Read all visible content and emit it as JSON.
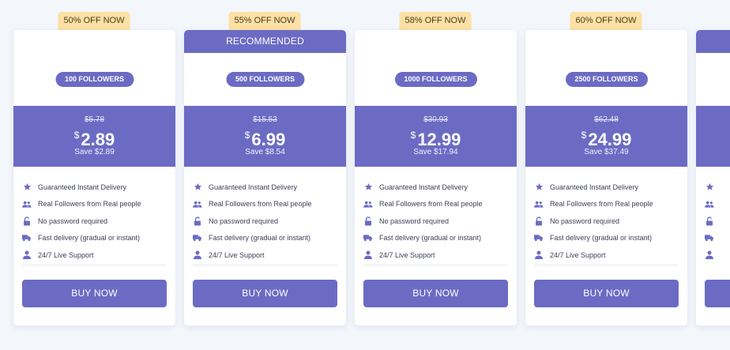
{
  "colors": {
    "accent": "#6b6bc4",
    "badge": "#fde0a4",
    "background": "#f3f6fb"
  },
  "features": [
    {
      "icon": "star-icon",
      "label": "Guaranteed Instant Delivery"
    },
    {
      "icon": "users-icon",
      "label": "Real Followers from Real people"
    },
    {
      "icon": "unlock-icon",
      "label": "No password required"
    },
    {
      "icon": "truck-icon",
      "label": "Fast delivery (gradual or instant)"
    },
    {
      "icon": "user-icon",
      "label": "24/7 Live Support"
    }
  ],
  "plans": [
    {
      "discount": "50% OFF NOW",
      "recommended": "",
      "package": "100 FOLLOWERS",
      "old_price": "$5.78",
      "currency": "$",
      "price": "2.89",
      "save": "Save $2.89",
      "button": "BUY NOW"
    },
    {
      "discount": "55% OFF NOW",
      "recommended": "RECOMMENDED",
      "package": "500 FOLLOWERS",
      "old_price": "$15.53",
      "currency": "$",
      "price": "6.99",
      "save": "Save $8.54",
      "button": "BUY NOW"
    },
    {
      "discount": "58% OFF NOW",
      "recommended": "",
      "package": "1000 FOLLOWERS",
      "old_price": "$30.93",
      "currency": "$",
      "price": "12.99",
      "save": "Save $17.94",
      "button": "BUY NOW"
    },
    {
      "discount": "60% OFF NOW",
      "recommended": "",
      "package": "2500 FOLLOWERS",
      "old_price": "$62.48",
      "currency": "$",
      "price": "24.99",
      "save": "Save $37.49",
      "button": "BUY NOW"
    }
  ]
}
